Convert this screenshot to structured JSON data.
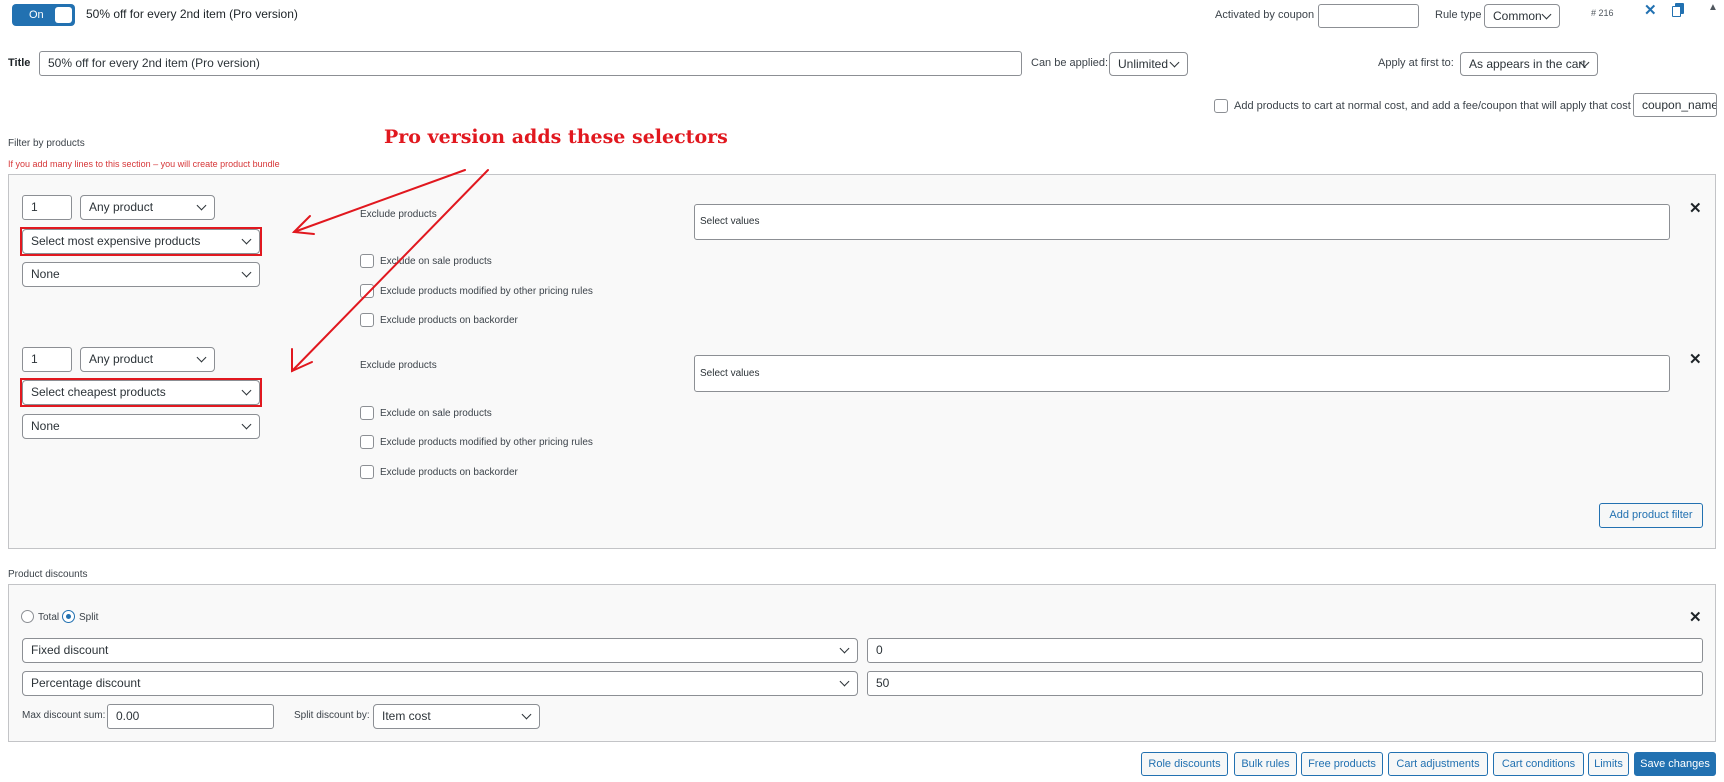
{
  "header": {
    "toggle_label": "On",
    "rule_title": "50% off for every 2nd item (Pro version)",
    "activated_by_coupon_label": "Activated by coupon",
    "coupon_value": "",
    "rule_type_label": "Rule type",
    "rule_type_value": "Common",
    "rule_id": "# 216"
  },
  "title_row": {
    "title_label": "Title",
    "title_value": "50% off for every 2nd item (Pro version)",
    "can_be_applied_label": "Can be applied:",
    "can_be_applied_value": "Unlimited",
    "apply_first_label": "Apply at first to:",
    "apply_first_value": "As appears in the cart"
  },
  "add_products_option": {
    "label": "Add products to cart at normal cost, and add a fee/coupon that will apply that cost",
    "coupon_name": "coupon_name"
  },
  "filter_section": {
    "heading": "Filter by products",
    "warning": "If you add many lines to this section – you will create product bundle",
    "annotation": "Pro version adds these selectors",
    "filters": [
      {
        "qty": "1",
        "product_type": "Any product",
        "selector": "Select most expensive products",
        "third": "None",
        "exclude_label": "Exclude products",
        "exclude_placeholder": "Select values",
        "checkboxes": [
          "Exclude on sale products",
          "Exclude products modified by other pricing rules",
          "Exclude products on backorder"
        ]
      },
      {
        "qty": "1",
        "product_type": "Any product",
        "selector": "Select cheapest products",
        "third": "None",
        "exclude_label": "Exclude products",
        "exclude_placeholder": "Select values",
        "checkboxes": [
          "Exclude on sale products",
          "Exclude products modified by other pricing rules",
          "Exclude products on backorder"
        ]
      }
    ],
    "add_filter_button": "Add product filter"
  },
  "discounts_section": {
    "heading": "Product discounts",
    "radio_total": "Total",
    "radio_split": "Split",
    "rows": [
      {
        "type": "Fixed discount",
        "value": "0"
      },
      {
        "type": "Percentage discount",
        "value": "50"
      }
    ],
    "max_discount_label": "Max discount sum:",
    "max_discount_value": "0.00",
    "split_by_label": "Split discount by:",
    "split_by_value": "Item cost"
  },
  "footer_buttons": {
    "role": "Role discounts",
    "bulk": "Bulk rules",
    "free": "Free products",
    "cart_adj": "Cart adjustments",
    "cart_cond": "Cart conditions",
    "limits": "Limits",
    "save": "Save changes"
  },
  "colors": {
    "accent": "#2271b1",
    "annotation": "#e1181f"
  },
  "icons": {
    "close": "close-icon",
    "copy": "copy-icon",
    "collapse": "collapse-icon",
    "chevron": "chevron-down-icon"
  }
}
